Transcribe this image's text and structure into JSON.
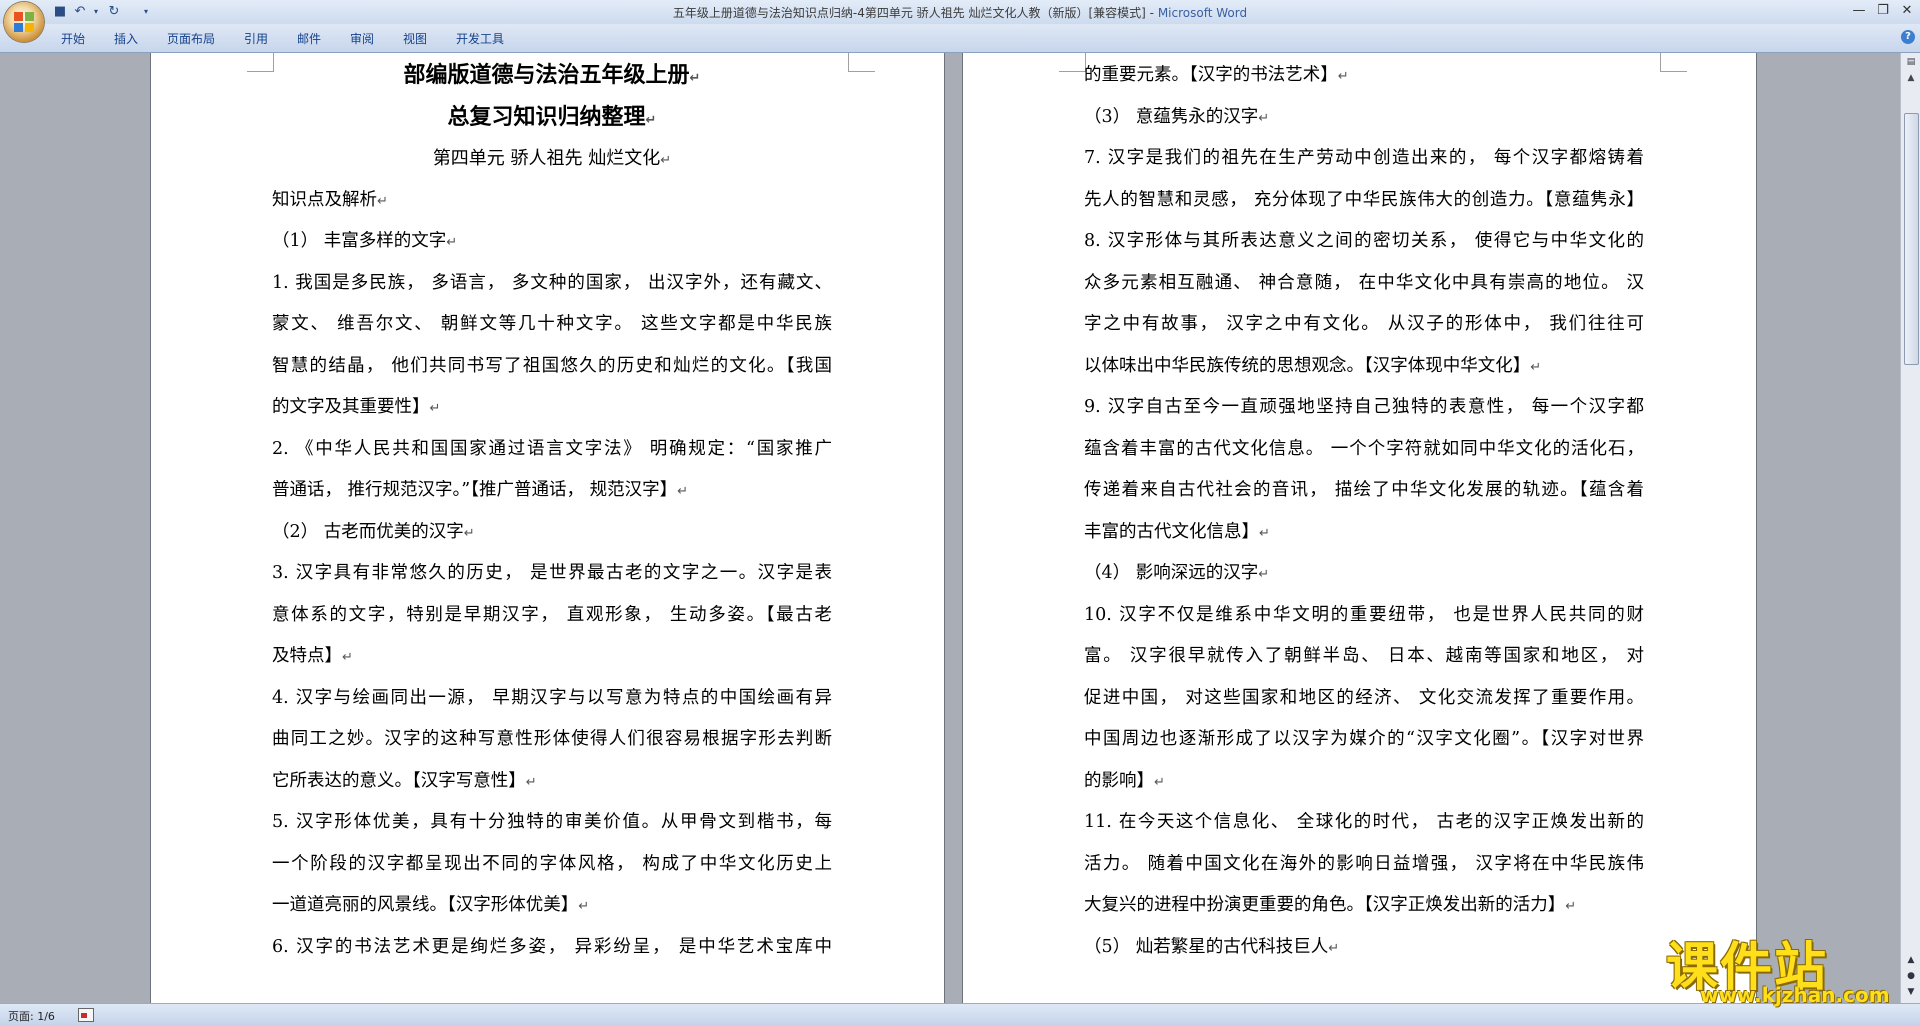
{
  "window": {
    "title": "五年级上册道德与法治知识点归纳-4第四单元 骄人祖先 灿烂文化人教（新版）[兼容模式]",
    "app_name": "Microsoft Word",
    "controls": [
      "minimize",
      "restore",
      "close"
    ]
  },
  "quick_access": [
    "save-icon",
    "undo-icon",
    "redo-icon",
    "customize-icon"
  ],
  "ribbon": {
    "tabs": [
      "开始",
      "插入",
      "页面布局",
      "引用",
      "邮件",
      "审阅",
      "视图",
      "开发工具"
    ]
  },
  "page1": {
    "title1": "部编版道德与法治五年级上册",
    "title2": "总复习知识归纳整理",
    "subtitle": "第四单元  骄人祖先  灿烂文化",
    "lines": [
      "知识点及解析",
      "（1） 丰富多样的文字",
      "1. 我国是多民族， 多语言， 多文种的国家， 出汉字外，还有藏文、",
      "蒙文、 维吾尔文、 朝鲜文等几十种文字。 这些文字都是中华民族",
      "智慧的结晶， 他们共同书写了祖国悠久的历史和灿烂的文化。【我国",
      "的文字及其重要性】",
      "2. 《中华人民共和国国家通过语言文字法》 明确规定：“国家推广",
      "普通话， 推行规范汉字。”【推广普通话， 规范汉字】",
      "（2） 古老而优美的汉字",
      "3. 汉字具有非常悠久的历史， 是世界最古老的文字之一。汉字是表",
      "意体系的文字，特别是早期汉字， 直观形象， 生动多姿。【最古老",
      "及特点】",
      "4. 汉字与绘画同出一源， 早期汉字与以写意为特点的中国绘画有异",
      "曲同工之妙。汉字的这种写意性形体使得人们很容易根据字形去判断",
      "它所表达的意义。【汉字写意性】",
      "5. 汉字形体优美，具有十分独特的审美价值。从甲骨文到楷书，每",
      "一个阶段的汉字都呈现出不同的字体风格， 构成了中华文化历史上",
      "一道道亮丽的风景线。【汉字形体优美】",
      "6. 汉字的书法艺术更是绚烂多姿， 异彩纷呈， 是中华艺术宝库中"
    ]
  },
  "page2": {
    "lines": [
      "的重要元素。【汉字的书法艺术】",
      "（3） 意蕴隽永的汉字",
      "7. 汉字是我们的祖先在生产劳动中创造出来的， 每个汉字都熔铸着",
      "先人的智慧和灵感， 充分体现了中华民族伟大的创造力。【意蕴隽永】",
      "8. 汉字形体与其所表达意义之间的密切关系， 使得它与中华文化的",
      "众多元素相互融通、 神合意随， 在中华文化中具有崇高的地位。 汉",
      "字之中有故事， 汉字之中有文化。 从汉子的形体中， 我们往往可",
      "以体味出中华民族传统的思想观念。【汉字体现中华文化】",
      "9. 汉字自古至今一直顽强地坚持自己独特的表意性， 每一个汉字都",
      "蕴含着丰富的古代文化信息。 一个个字符就如同中华文化的活化石，",
      "传递着来自古代社会的音讯， 描绘了中华文化发展的轨迹。【蕴含着",
      "丰富的古代文化信息】",
      "（4） 影响深远的汉字",
      "10. 汉字不仅是维系中华文明的重要纽带， 也是世界人民共同的财",
      "富。 汉字很早就传入了朝鲜半岛、 日本、越南等国家和地区， 对",
      "促进中国， 对这些国家和地区的经济、 文化交流发挥了重要作用。",
      "中国周边也逐渐形成了以汉字为媒介的“汉字文化圈”。【汉字对世界",
      "的影响】",
      "11. 在今天这个信息化、 全球化的时代， 古老的汉字正焕发出新的",
      "活力。 随着中国文化在海外的影响日益增强， 汉字将在中华民族伟",
      "大复兴的进程中扮演更重要的角色。【汉字正焕发出新的活力】",
      "（5） 灿若繁星的古代科技巨人"
    ]
  },
  "status": {
    "page_label": "页面: 1/6"
  },
  "watermark": {
    "title": "课件站",
    "url": "www.kjzhan.com"
  },
  "colors": {
    "workspace": "#a9aeb6",
    "ribbon": "#c7d6ec",
    "tab_text": "#15428b",
    "watermark": "#ffdf1a"
  }
}
